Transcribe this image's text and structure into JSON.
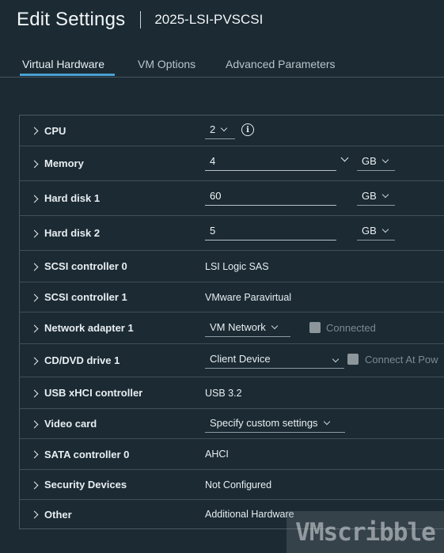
{
  "header": {
    "title": "Edit Settings",
    "vm_name": "2025-LSI-PVSCSI"
  },
  "tabs": [
    {
      "label": "Virtual Hardware",
      "active": true
    },
    {
      "label": "VM Options",
      "active": false
    },
    {
      "label": "Advanced Parameters",
      "active": false
    }
  ],
  "hardware": {
    "cpu": {
      "label": "CPU",
      "value": "2"
    },
    "memory": {
      "label": "Memory",
      "value": "4",
      "unit": "GB"
    },
    "hard_disk_1": {
      "label": "Hard disk 1",
      "value": "60",
      "unit": "GB"
    },
    "hard_disk_2": {
      "label": "Hard disk 2",
      "value": "5",
      "unit": "GB"
    },
    "scsi_controller_0": {
      "label": "SCSI controller 0",
      "value": "LSI Logic SAS"
    },
    "scsi_controller_1": {
      "label": "SCSI controller 1",
      "value": "VMware Paravirtual"
    },
    "network_adapter_1": {
      "label": "Network adapter 1",
      "value": "VM Network",
      "checkbox_label": "Connected",
      "checked": false
    },
    "cd_dvd_drive_1": {
      "label": "CD/DVD drive 1",
      "value": "Client Device",
      "checkbox_label": "Connect At Pow",
      "checked": false
    },
    "usb_controller": {
      "label": "USB xHCI controller",
      "value": "USB 3.2"
    },
    "video_card": {
      "label": "Video card",
      "value": "Specify custom settings"
    },
    "sata_controller_0": {
      "label": "SATA controller 0",
      "value": "AHCI"
    },
    "security_devices": {
      "label": "Security Devices",
      "value": "Not Configured"
    },
    "other": {
      "label": "Other",
      "value": "Additional Hardware"
    }
  },
  "watermark": {
    "text": "VMscribble"
  },
  "colors": {
    "background": "#1b2a33",
    "accent": "#4aa0d5",
    "border": "#4a5a62"
  }
}
